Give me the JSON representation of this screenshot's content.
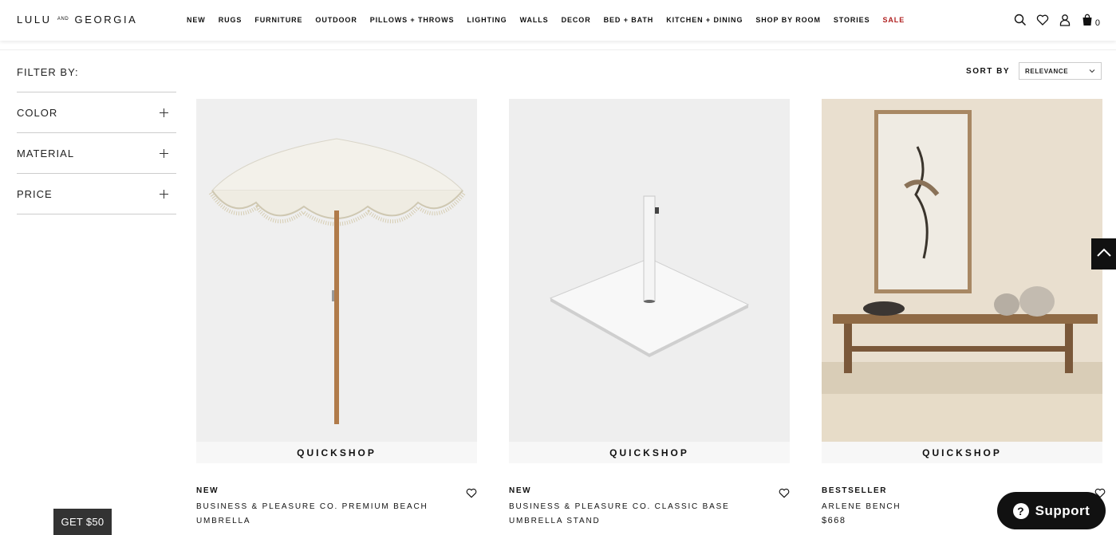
{
  "brand": {
    "logo_left": "LULU",
    "logo_and": "AND",
    "logo_right": "GEORGIA"
  },
  "nav": [
    {
      "label": "NEW"
    },
    {
      "label": "RUGS"
    },
    {
      "label": "FURNITURE"
    },
    {
      "label": "OUTDOOR"
    },
    {
      "label": "PILLOWS + THROWS"
    },
    {
      "label": "LIGHTING"
    },
    {
      "label": "WALLS"
    },
    {
      "label": "DECOR"
    },
    {
      "label": "BED + BATH"
    },
    {
      "label": "KITCHEN + DINING"
    },
    {
      "label": "SHOP BY ROOM"
    },
    {
      "label": "STORIES"
    },
    {
      "label": "SALE"
    }
  ],
  "header_icons": {
    "search": "search-icon",
    "wishlist": "heart-icon",
    "account": "user-icon",
    "cart": "bag-icon",
    "cart_count": "0"
  },
  "filters": {
    "title": "FILTER BY:",
    "items": [
      {
        "label": "COLOR"
      },
      {
        "label": "MATERIAL"
      },
      {
        "label": "PRICE"
      }
    ]
  },
  "sort": {
    "label": "SORT BY",
    "selected": "RELEVANCE"
  },
  "products": [
    {
      "badge": "NEW",
      "name": "BUSINESS & PLEASURE CO. PREMIUM BEACH UMBRELLA",
      "price": "",
      "quickshop": "QUICKSHOP"
    },
    {
      "badge": "NEW",
      "name": "BUSINESS & PLEASURE CO. CLASSIC BASE UMBRELLA STAND",
      "price": "",
      "quickshop": "QUICKSHOP"
    },
    {
      "badge": "BESTSELLER",
      "name": "ARLENE BENCH",
      "price": "$668",
      "quickshop": "QUICKSHOP"
    }
  ],
  "promo": {
    "label": "GET $50"
  },
  "support": {
    "label": "Support"
  },
  "colors": {
    "sale": "#b02020",
    "dark": "#111111",
    "promo_bg": "#333333"
  }
}
